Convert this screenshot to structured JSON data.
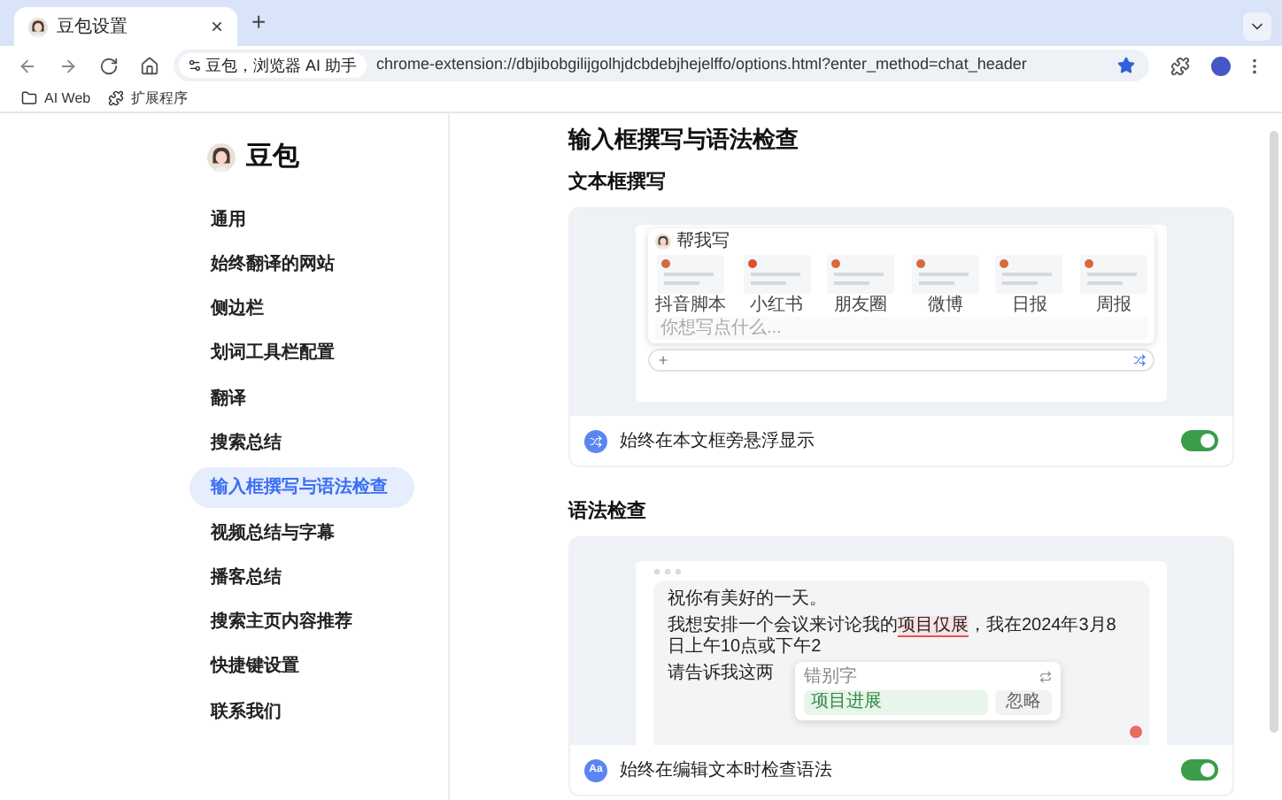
{
  "browser": {
    "tab": {
      "title": "豆包设置",
      "close": "×"
    },
    "new_tab": "+",
    "site_chip": "豆包，浏览器 AI 助手",
    "url": "chrome-extension://dbjibobgilijgolhjdcbdebjhejelffo/options.html?enter_method=chat_header",
    "bookmarked": true,
    "bookmarks": [
      {
        "label": "AI Web",
        "kind": "folder"
      },
      {
        "label": "扩展程序",
        "kind": "extension"
      }
    ]
  },
  "sidebar": {
    "brand": "豆包",
    "items": [
      {
        "label": "通用",
        "selected": false
      },
      {
        "label": "始终翻译的网站",
        "selected": false
      },
      {
        "label": "侧边栏",
        "selected": false
      },
      {
        "label": "划词工具栏配置",
        "selected": false
      },
      {
        "label": "翻译",
        "selected": false
      },
      {
        "label": "搜索总结",
        "selected": false
      },
      {
        "label": "输入框撰写与语法检查",
        "selected": true
      },
      {
        "label": "视频总结与字幕",
        "selected": false
      },
      {
        "label": "播客总结",
        "selected": false
      },
      {
        "label": "搜索主页内容推荐",
        "selected": false
      },
      {
        "label": "快捷键设置",
        "selected": false
      },
      {
        "label": "联系我们",
        "selected": false
      }
    ]
  },
  "main": {
    "title": "输入框撰写与语法检查",
    "sections": [
      {
        "heading": "文本框撰写",
        "illustration": {
          "kind": "writing",
          "popup_title": "帮我写",
          "templates": [
            "抖音脚本",
            "小红书",
            "朋友圈",
            "微博",
            "日报",
            "周报"
          ],
          "placeholder": "你想写点什么..."
        },
        "option": {
          "label": "始终在本文框旁悬浮显示",
          "on": true
        }
      },
      {
        "heading": "语法检查",
        "illustration": {
          "kind": "grammar",
          "greeting": "祝你有美好的一天。",
          "before": "我想安排一个会议来讨论我的",
          "error": "项目仅展",
          "after": "，我在2024年3月8日上午10点或下午2",
          "last_line": "请告诉我这两",
          "popup_title": "错别字",
          "suggestion": "项目进展",
          "ignore": "忽略"
        },
        "option": {
          "label": "始终在编辑文本时检查语法",
          "icon_text": "Aa",
          "on": true
        }
      }
    ]
  }
}
